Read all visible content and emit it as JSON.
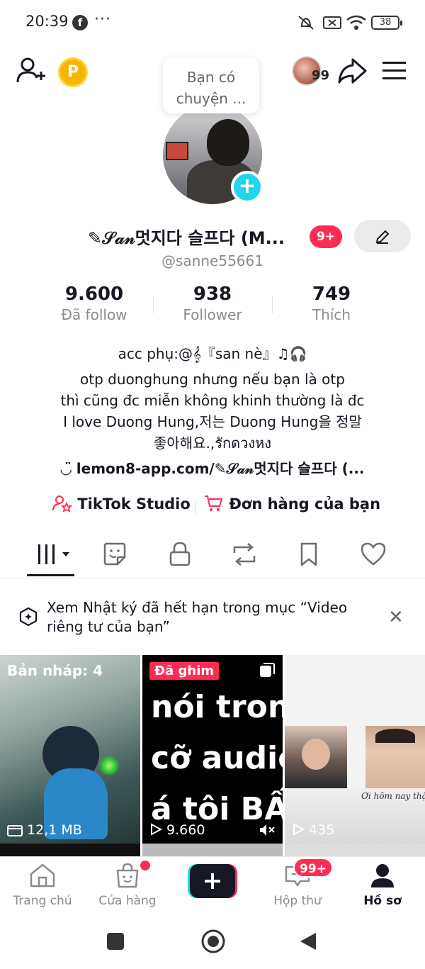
{
  "status": {
    "time": "20:39",
    "battery": "38"
  },
  "header": {
    "coin_label": "P",
    "story_count": "99",
    "note_bubble": "Bạn có chuyện ..."
  },
  "profile": {
    "display_name": "✎𝒮𝒶𝓃멋지다 슬프다 (M...",
    "notification_badge": "9+",
    "handle": "@sanne55661",
    "stats": [
      {
        "value": "9.600",
        "label": "Đã follow"
      },
      {
        "value": "938",
        "label": "Follower"
      },
      {
        "value": "749",
        "label": "Thích"
      }
    ],
    "bio_lines": [
      "acc phụ:@𝄞『san nè』♫🎧",
      "otp duonghung nhưng nếu bạn là otp",
      "thì cũng đc miễn không khinh thường là đc",
      "I love Duong Hung,저는 Duong Hung을 정말",
      "좋아해요.,รักดวงหง"
    ],
    "link": "lemon8-app.com/✎𝒮𝒶𝓃멋지다 슬프다 (..."
  },
  "shortcuts": {
    "studio": "TikTok Studio",
    "orders": "Đơn hàng của bạn"
  },
  "notice": {
    "text": "Xem Nhật ký đã hết hạn trong mục “Video riêng tư của bạn”"
  },
  "grid": [
    {
      "label": "Bản nháp: 4",
      "meta": "12,1 MB"
    },
    {
      "label": "Đã ghim",
      "lines": [
        "nói trong",
        "cỡ audio",
        "á tôi BẤT"
      ],
      "meta": "9.660"
    },
    {
      "caption": "Ơi hôm nay thật v",
      "meta": "435"
    }
  ],
  "bottom_nav": {
    "items": [
      {
        "label": "Trang chủ"
      },
      {
        "label": "Cửa hàng"
      },
      {
        "label": "Hộp thư"
      },
      {
        "label": "Hồ sơ"
      }
    ],
    "inbox_badge": "99+"
  }
}
